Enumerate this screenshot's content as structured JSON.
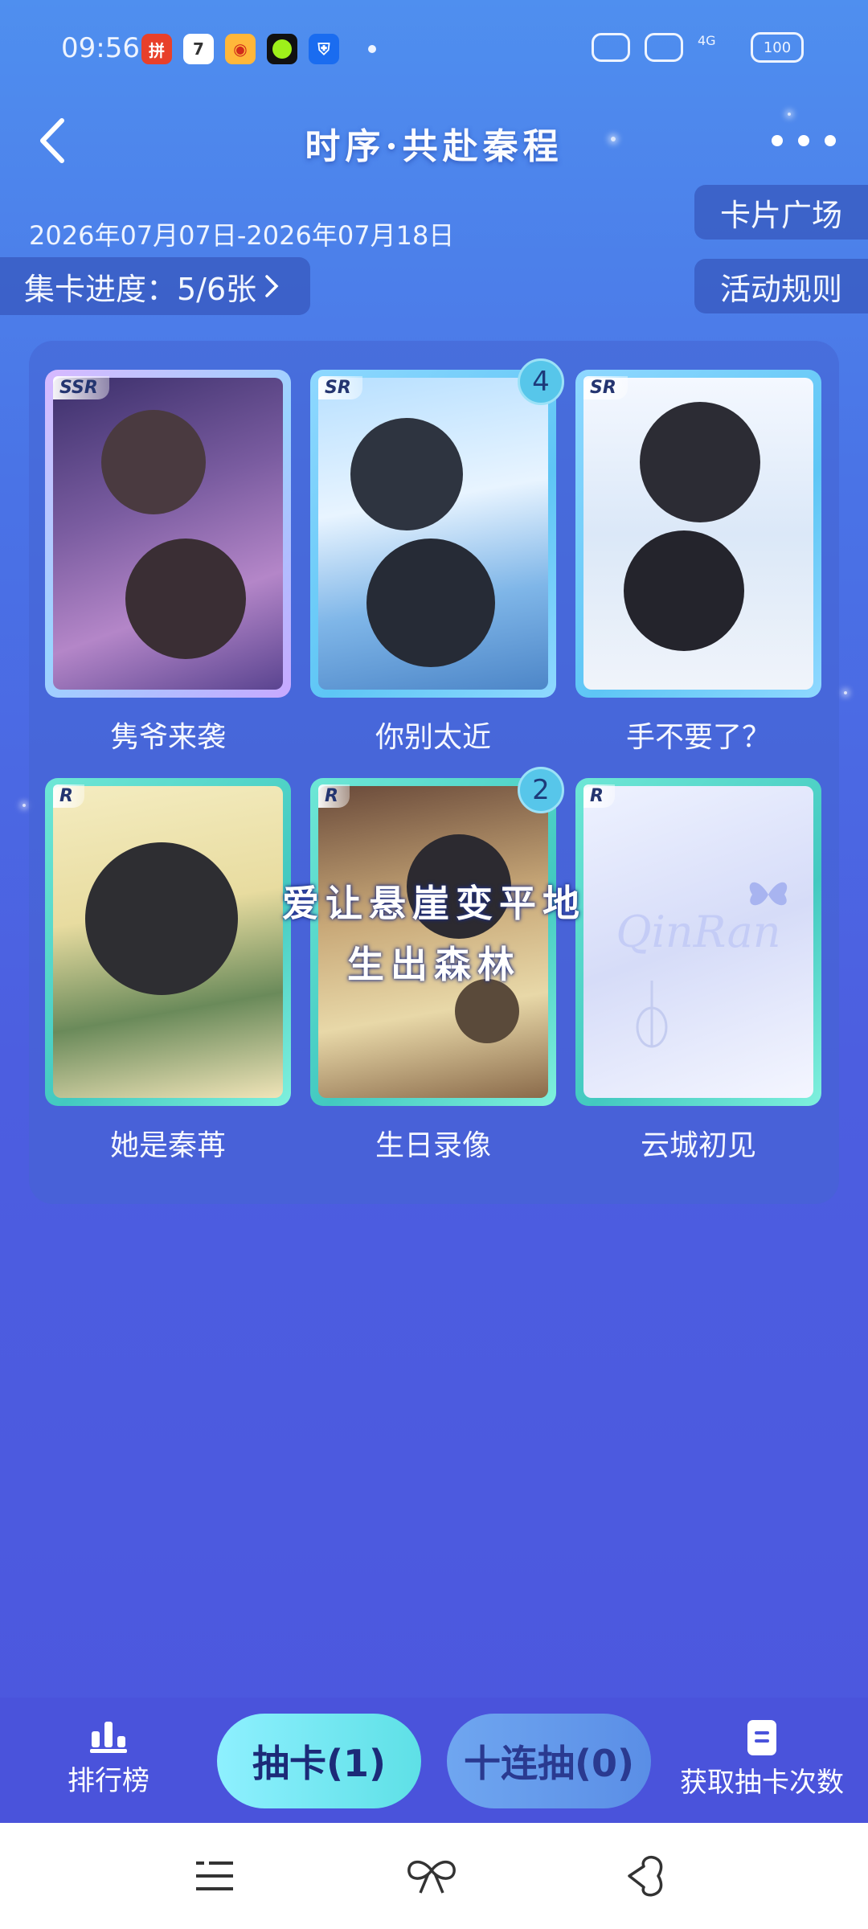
{
  "status_bar": {
    "time": "09:56",
    "app_icons": [
      "pinduoduo-icon",
      "calendar-icon",
      "weibo-icon",
      "green-circle-app-icon",
      "shield-app-icon"
    ],
    "calendar_day": "7",
    "battery": "100"
  },
  "header": {
    "title": "时序·共赴秦程",
    "date_range": "2026年07月07日-2026年07月18日",
    "card_plaza_label": "卡片广场",
    "rules_label": "活动规则",
    "progress_label": "集卡进度：5/6张"
  },
  "cards": [
    {
      "name": "隽爷来袭",
      "rarity": "SSR",
      "count": ""
    },
    {
      "name": "你别太近",
      "rarity": "SR",
      "count": "4"
    },
    {
      "name": "手不要了？",
      "rarity": "SR",
      "count": ""
    },
    {
      "name": "她是秦苒",
      "rarity": "R",
      "count": ""
    },
    {
      "name": "生日录像",
      "rarity": "R",
      "count": "2"
    },
    {
      "name": "云城初见",
      "rarity": "R",
      "count": ""
    }
  ],
  "card_art_text": {
    "logo": "QinRan"
  },
  "overlay": {
    "line1": "爱让悬崖变平地",
    "line2": "生出森林"
  },
  "actions": {
    "leaderboard_label": "排行榜",
    "draw_label": "抽卡(1)",
    "draw_ten_label": "十连抽(0)",
    "get_draws_label": "获取抽卡次数"
  },
  "colors": {
    "accent_cyan": "#5ee0e6",
    "panel": "#4664d2",
    "background_top": "#4f8fef",
    "background_bottom": "#4c56de"
  }
}
